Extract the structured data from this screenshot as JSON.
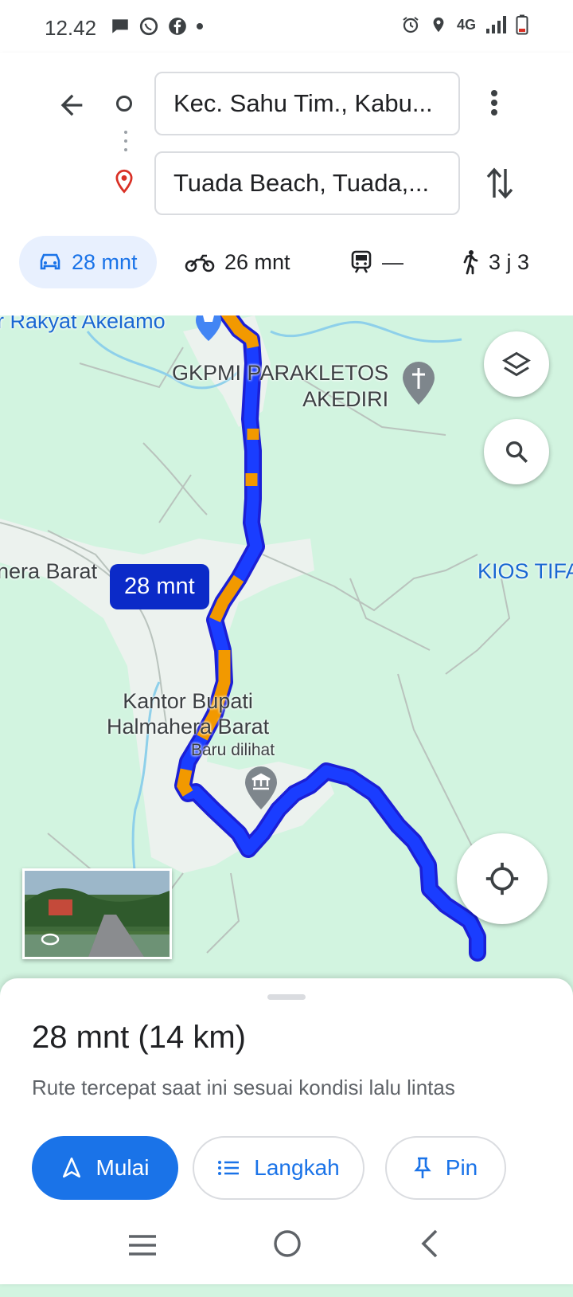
{
  "status_bar": {
    "time": "12.42",
    "network": "4G",
    "left_icons": [
      "chat-bubble-icon",
      "whatsapp-icon",
      "facebook-icon",
      "dot-icon"
    ],
    "right_icons": [
      "alarm-icon",
      "location-icon",
      "signal-icon",
      "battery-icon"
    ]
  },
  "directions": {
    "origin": "Kec. Sahu Tim., Kabu...",
    "destination": "Tuada Beach, Tuada,..."
  },
  "modes": [
    {
      "icon": "car-icon",
      "label": "28 mnt",
      "active": true
    },
    {
      "icon": "motorcycle-icon",
      "label": "26 mnt",
      "active": false
    },
    {
      "icon": "train-icon",
      "label": "—",
      "active": false
    },
    {
      "icon": "walk-icon",
      "label": "3 j 3",
      "active": false
    }
  ],
  "map": {
    "labels": {
      "rakyat": "r Rakyat Akelamo",
      "church": "GKPMI PARAKLETOS\nAKEDIRI",
      "halmahera": "nera Barat",
      "kios": "KIOS TIFA",
      "kantor": "Kantor Bupati\nHalmahera Barat",
      "baru": "Baru dilihat"
    },
    "eta_bubble": "28 mnt",
    "route_color": "#1a1aff",
    "traffic_color": "#f29900"
  },
  "sheet": {
    "title": "28 mnt (14 km)",
    "description": "Rute tercepat saat ini sesuai kondisi lalu lintas",
    "start_label": "Mulai",
    "steps_label": "Langkah",
    "pin_label": "Pin"
  },
  "colors": {
    "accent": "#1a73e8",
    "map_bg": "#d2f4e0"
  }
}
